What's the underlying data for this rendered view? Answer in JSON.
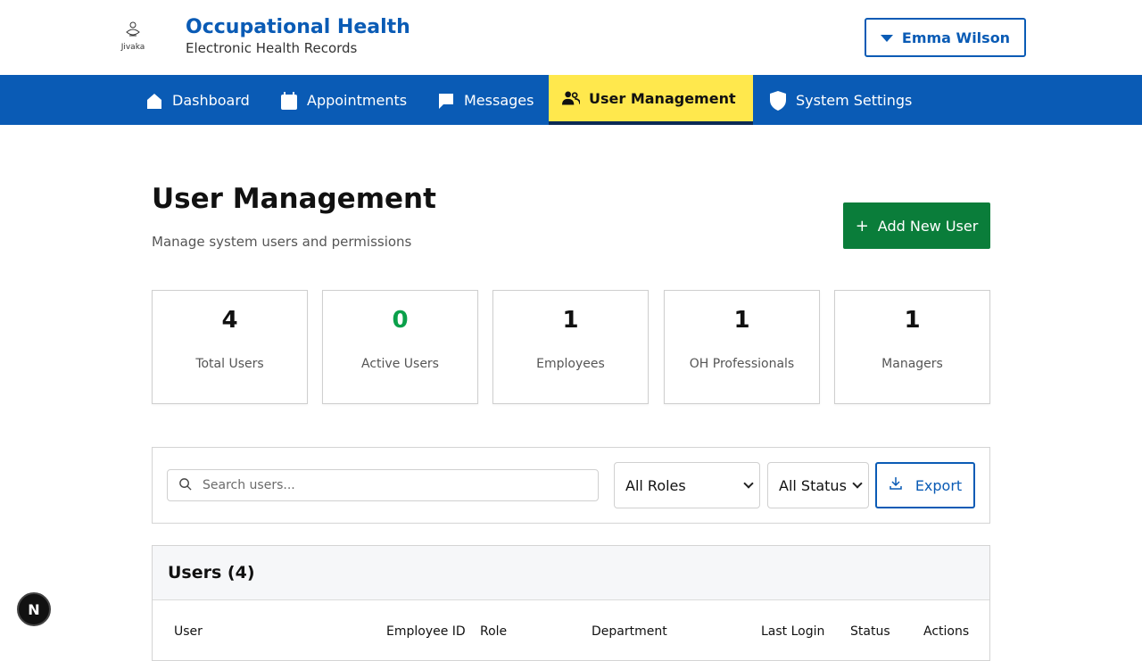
{
  "brand": {
    "logo_text": "Jivaka",
    "title": "Occupational Health",
    "subtitle": "Electronic Health Records"
  },
  "user_menu": {
    "name": "Emma Wilson"
  },
  "nav": {
    "items": [
      {
        "label": "Dashboard",
        "icon": "home-icon"
      },
      {
        "label": "Appointments",
        "icon": "calendar-icon"
      },
      {
        "label": "Messages",
        "icon": "message-icon"
      },
      {
        "label": "User Management",
        "icon": "users-icon",
        "active": true
      },
      {
        "label": "System Settings",
        "icon": "shield-icon"
      }
    ]
  },
  "page": {
    "title": "User Management",
    "subtitle": "Manage system users and permissions",
    "add_button": "Add New User"
  },
  "stats": [
    {
      "value": "4",
      "label": "Total Users"
    },
    {
      "value": "0",
      "label": "Active Users",
      "color": "#0aa04a"
    },
    {
      "value": "1",
      "label": "Employees"
    },
    {
      "value": "1",
      "label": "OH Professionals"
    },
    {
      "value": "1",
      "label": "Managers"
    }
  ],
  "filters": {
    "search_placeholder": "Search users...",
    "role_selected": "All Roles",
    "status_selected": "All Status",
    "export_label": "Export"
  },
  "users_table": {
    "title": "Users (4)",
    "columns": [
      "User",
      "Employee ID",
      "Role",
      "Department",
      "Last Login",
      "Status",
      "Actions"
    ]
  },
  "badge": {
    "letter": "N"
  },
  "colors": {
    "brand_blue": "#0a5bb5",
    "active_tab": "#ffe84d",
    "add_green": "#0a7d3a",
    "active_users_green": "#0aa04a"
  }
}
